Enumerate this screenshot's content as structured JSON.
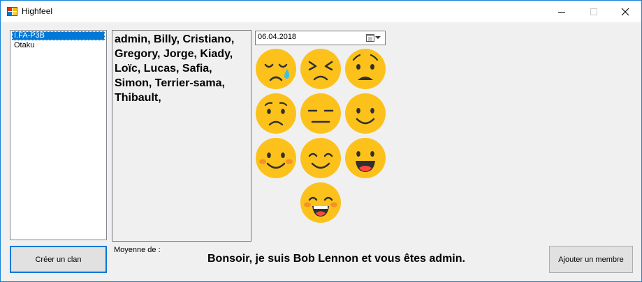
{
  "window": {
    "title": "Highfeel"
  },
  "clans": {
    "items": [
      {
        "label": "I.FA-P3B",
        "selected": true
      },
      {
        "label": "Otaku",
        "selected": false
      }
    ]
  },
  "members": {
    "text": "admin, Billy, Cristiano, Gregory, Jorge, Kiady, Loïc, Lucas, Safia, Simon, Terrier-sama, Thibault,"
  },
  "date": {
    "value": "06.04.2018"
  },
  "moods": {
    "colors": {
      "face": "#fcc21b",
      "features": "#2f2f2f",
      "tear": "#40c0e7",
      "blush": "#ed6c30",
      "mouth": "#ff473e"
    },
    "emojis": [
      "crying-face-icon",
      "tightly-closed-eyes-face-icon",
      "worried-face-icon",
      "frowning-face-icon",
      "neutral-face-icon",
      "slight-smile-face-icon",
      "blushing-smile-face-icon",
      "happy-smile-face-icon",
      "open-mouth-grin-face-icon",
      "laughing-blushing-face-icon"
    ]
  },
  "footer": {
    "create_clan": "Créer un clan",
    "moyenne_label": "Moyenne de :",
    "greeting": "Bonsoir, je suis Bob Lennon et vous êtes admin.",
    "add_member": "Ajouter un membre"
  }
}
